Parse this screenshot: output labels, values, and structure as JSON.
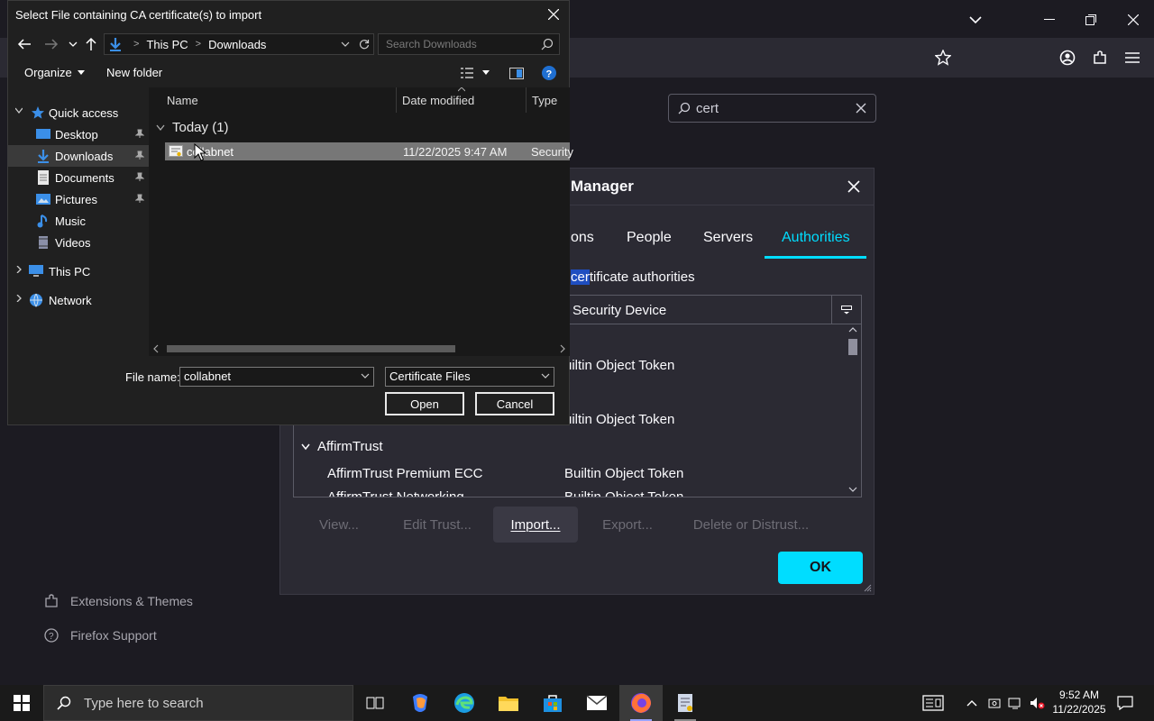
{
  "firefox": {
    "search_value": "cert",
    "side_links": [
      "Extensions & Themes",
      "Firefox Support"
    ]
  },
  "cert_manager": {
    "title": "Manager",
    "tabs": [
      "ons",
      "People",
      "Servers",
      "Authorities"
    ],
    "active_tab": "Authorities",
    "description_highlight": "cer",
    "description_rest": "tificate authorities",
    "column_header": "Security Device",
    "rows": [
      {
        "name": "",
        "device": "uiltin Object Token"
      },
      {
        "name": "",
        "device": "uiltin Object Token"
      },
      {
        "name": "AffirmTrust",
        "device": ""
      },
      {
        "name": "AffirmTrust Premium ECC",
        "device": "Builtin Object Token"
      },
      {
        "name": "AffirmTrust Networking",
        "device": "Builtin Object Token"
      }
    ],
    "buttons": {
      "view": "View...",
      "edit_trust": "Edit Trust...",
      "import": "Import...",
      "export": "Export...",
      "delete": "Delete or Distrust...",
      "ok": "OK"
    }
  },
  "file_dialog": {
    "title": "Select File containing CA certificate(s) to import",
    "breadcrumb": [
      "This PC",
      "Downloads"
    ],
    "search_placeholder": "Search Downloads",
    "toolbar": {
      "organize": "Organize",
      "new_folder": "New folder"
    },
    "nav_items": {
      "quick_access": "Quick access",
      "desktop": "Desktop",
      "downloads": "Downloads",
      "documents": "Documents",
      "pictures": "Pictures",
      "music": "Music",
      "videos": "Videos",
      "this_pc": "This PC",
      "network": "Network"
    },
    "columns": [
      "Name",
      "Date modified",
      "Type"
    ],
    "group": "Today (1)",
    "file": {
      "name": "collabnet",
      "date": "11/22/2025 9:47 AM",
      "type": "Security"
    },
    "file_name_label": "File name:",
    "file_name_value": "collabnet",
    "file_type_value": "Certificate Files",
    "open_label": "Open",
    "cancel_label": "Cancel"
  },
  "taskbar": {
    "search_placeholder": "Type here to search",
    "time": "9:52 AM",
    "date": "11/22/2025"
  },
  "colors": {
    "accent": "#00ddff",
    "selection_highlight": "#1f4ec0"
  }
}
